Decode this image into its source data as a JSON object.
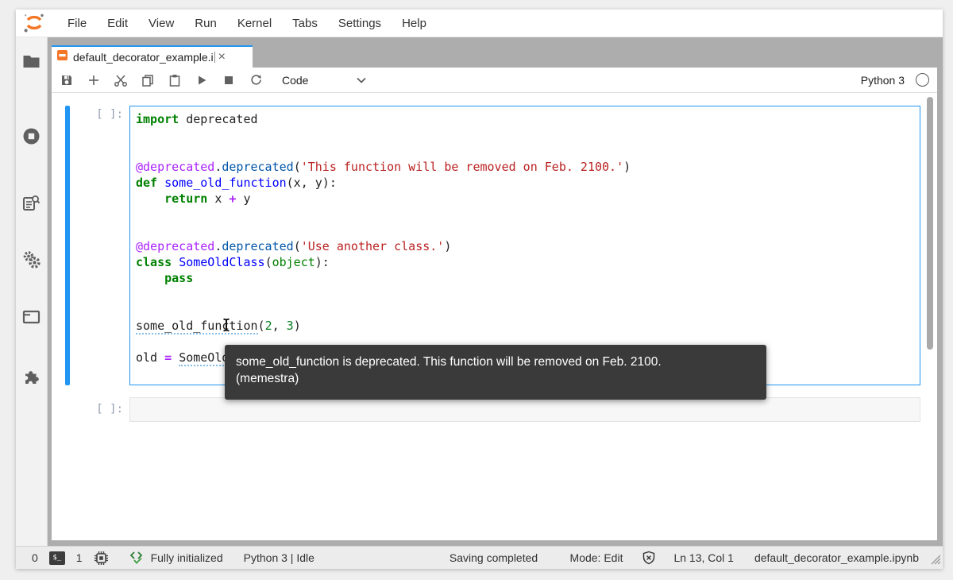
{
  "menu": {
    "items": [
      {
        "name": "file",
        "label": "File"
      },
      {
        "name": "edit",
        "label": "Edit"
      },
      {
        "name": "view",
        "label": "View"
      },
      {
        "name": "run",
        "label": "Run"
      },
      {
        "name": "kernel",
        "label": "Kernel"
      },
      {
        "name": "tabs",
        "label": "Tabs"
      },
      {
        "name": "settings",
        "label": "Settings"
      },
      {
        "name": "help",
        "label": "Help"
      }
    ]
  },
  "sidebar": {
    "items": [
      {
        "icon": "file-browser-icon"
      },
      {
        "icon": "running-kernels-icon"
      },
      {
        "icon": "property-inspector-icon"
      },
      {
        "icon": "settings-gears-icon"
      },
      {
        "icon": "open-tabs-icon"
      },
      {
        "icon": "extension-manager-icon"
      }
    ]
  },
  "tab": {
    "title": "default_decorator_example.i",
    "close_glyph": "×"
  },
  "toolbar": {
    "buttons": [
      {
        "icon": "save-icon"
      },
      {
        "icon": "add-cell-icon"
      },
      {
        "icon": "cut-icon"
      },
      {
        "icon": "copy-icon"
      },
      {
        "icon": "paste-icon"
      },
      {
        "icon": "run-icon"
      },
      {
        "icon": "stop-icon"
      },
      {
        "icon": "restart-icon"
      }
    ],
    "cell_type": "Code",
    "kernel_name": "Python 3"
  },
  "cells": [
    {
      "prompt": "[ ]:",
      "lines": [
        [
          [
            "kw",
            "import"
          ],
          [
            "pl",
            " deprecated"
          ]
        ],
        [],
        [],
        [
          [
            "meta",
            "@deprecated"
          ],
          [
            "pl",
            "."
          ],
          [
            "prop",
            "deprecated"
          ],
          [
            "pl",
            "("
          ],
          [
            "str",
            "'This function will be removed on Feb. 2100.'"
          ],
          [
            "pl",
            ")"
          ]
        ],
        [
          [
            "kw",
            "def"
          ],
          [
            "pl",
            " "
          ],
          [
            "def",
            "some_old_function"
          ],
          [
            "pl",
            "(x, y):"
          ]
        ],
        [
          [
            "pl",
            "    "
          ],
          [
            "kw",
            "return"
          ],
          [
            "pl",
            " x "
          ],
          [
            "op",
            "+"
          ],
          [
            "pl",
            " y"
          ]
        ],
        [],
        [],
        [
          [
            "meta",
            "@deprecated"
          ],
          [
            "pl",
            "."
          ],
          [
            "prop",
            "deprecated"
          ],
          [
            "pl",
            "("
          ],
          [
            "str",
            "'Use another class.'"
          ],
          [
            "pl",
            ")"
          ]
        ],
        [
          [
            "kw",
            "class"
          ],
          [
            "pl",
            " "
          ],
          [
            "def",
            "SomeOldClass"
          ],
          [
            "pl",
            "("
          ],
          [
            "bi",
            "object"
          ],
          [
            "pl",
            "):"
          ]
        ],
        [
          [
            "pl",
            "    "
          ],
          [
            "kw",
            "pass"
          ]
        ],
        [],
        [],
        [
          [
            "ul",
            "some_old_function"
          ],
          [
            "pl",
            "("
          ],
          [
            "num",
            "2"
          ],
          [
            "pl",
            ", "
          ],
          [
            "num",
            "3"
          ],
          [
            "pl",
            ")"
          ]
        ],
        [],
        [
          [
            "pl",
            "old "
          ],
          [
            "op",
            "="
          ],
          [
            "pl",
            " "
          ],
          [
            "ul",
            "SomeOldClass"
          ],
          [
            "pl",
            "()"
          ]
        ]
      ]
    },
    {
      "prompt": "[ ]:",
      "lines": []
    }
  ],
  "tooltip": {
    "line1": "some_old_function is deprecated. This function will be removed on Feb. 2100.",
    "line2": "(memestra)"
  },
  "statusbar": {
    "terminal_count": "0",
    "terminal_badge": "$_",
    "kernel_count": "1",
    "init_status": "Fully initialized",
    "kernel_info": "Python 3 | Idle",
    "save_status": "Saving completed",
    "mode": "Mode: Edit",
    "cursor_pos": "Ln 13, Col 1",
    "filename": "default_decorator_example.ipynb"
  },
  "colors": {
    "accent_blue": "#2196f3",
    "jupyter_orange": "#f37726",
    "dock_gray": "#adadad",
    "tooltip_bg": "#3a3a3a",
    "icon_gray": "#616161",
    "success_green": "#2e7d32"
  }
}
